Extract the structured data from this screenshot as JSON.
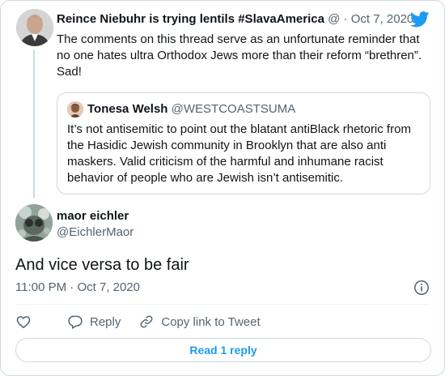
{
  "parent_tweet": {
    "author_name": "Reince Niebuhr is trying lentils #SlavaAmerica",
    "handle": "@",
    "separator": "·",
    "date": "Oct 7, 2020",
    "text": "The comments on this thread serve as an unfortunate reminder that no one hates ultra Orthodox Jews more than their reform “brethren”. Sad!",
    "brand_icon": "twitter-bird-icon"
  },
  "quoted_tweet": {
    "author_name": "Tonesa Welsh",
    "handle": "@WESTCOASTSUMA",
    "text": "It’s not antisemitic to point out the blatant antiBlack rhetoric from the Hasidic Jewish community in Brooklyn that are also anti maskers. Valid criticism of the harmful and inhumane racist behavior of people who are Jewish isn’t antisemitic."
  },
  "main_tweet": {
    "author_name": "maor eichler",
    "handle": "@EichlerMaor",
    "text": "And vice versa to be fair",
    "time": "11:00 PM",
    "separator": "·",
    "date": "Oct 7, 2020"
  },
  "actions": {
    "like_icon": "heart-icon",
    "reply_label": "Reply",
    "copy_link_label": "Copy link to Tweet"
  },
  "read_replies_label": "Read 1 reply",
  "colors": {
    "accent": "#1d9bf0",
    "text": "#0f1419",
    "secondary": "#536471",
    "border": "#cfd9de"
  }
}
